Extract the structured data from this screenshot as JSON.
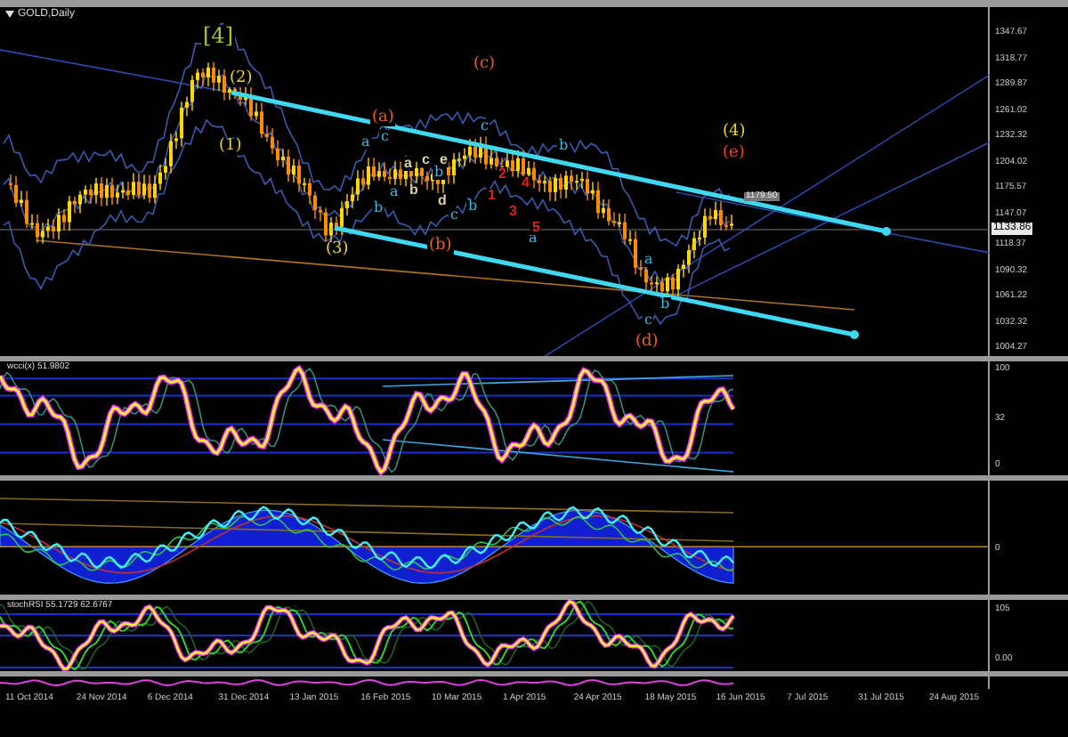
{
  "chart": {
    "title": "GOLD,Daily",
    "price_axis": [
      "1347.67",
      "1318.77",
      "1289.87",
      "1261.02",
      "1232.32",
      "1204.02",
      "1175.57",
      "1147.07",
      "1118.37",
      "1090.32",
      "1061.22",
      "1032.32",
      "1004.27"
    ],
    "current_price": "1133.86",
    "line_price": "1179.50",
    "wave_labels": [
      {
        "text": "[4]",
        "color": "#a8c832"
      },
      {
        "text": "(2)",
        "color": "#e8d040"
      },
      {
        "text": "(1)",
        "color": "#e8d040"
      },
      {
        "text": "(3)",
        "color": "#e8d040"
      },
      {
        "text": "(a)",
        "color": "#e8602a"
      },
      {
        "text": "(c)",
        "color": "#e8602a"
      },
      {
        "text": "(b)",
        "color": "#e8602a"
      },
      {
        "text": "(d)",
        "color": "#e8602a"
      },
      {
        "text": "(4)",
        "color": "#e8d040"
      },
      {
        "text": "(e)",
        "color": "#ff4020"
      },
      {
        "text": "a",
        "color": "#40b8e0"
      },
      {
        "text": "c",
        "color": "#40b8e0"
      },
      {
        "text": "b",
        "color": "#40b8e0"
      },
      {
        "text": "a",
        "color": "#40b8e0"
      },
      {
        "text": "b",
        "color": "#40b8e0"
      },
      {
        "text": "c",
        "color": "#40b8e0"
      },
      {
        "text": "b",
        "color": "#40b8e0"
      },
      {
        "text": "c",
        "color": "#40b8e0"
      },
      {
        "text": "b",
        "color": "#40b8e0"
      },
      {
        "text": "a",
        "color": "#40b8e0"
      },
      {
        "text": "a",
        "color": "#40b8e0"
      },
      {
        "text": "b",
        "color": "#40b8e0"
      },
      {
        "text": "c",
        "color": "#40b8e0"
      },
      {
        "text": "a",
        "color": "#d8d0a0"
      },
      {
        "text": "c",
        "color": "#d8d0a0"
      },
      {
        "text": "e",
        "color": "#d8d0a0"
      },
      {
        "text": "b",
        "color": "#d8d0a0"
      },
      {
        "text": "d",
        "color": "#d8d0a0"
      },
      {
        "text": "2",
        "color": "#e02020"
      },
      {
        "text": "1",
        "color": "#e02020"
      },
      {
        "text": "3",
        "color": "#e02020"
      },
      {
        "text": "4",
        "color": "#e02020"
      },
      {
        "text": "5",
        "color": "#e02020"
      }
    ]
  },
  "panels": [
    {
      "title": "wcci(x) 51.9802",
      "axis": [
        "100",
        "32",
        "0"
      ]
    },
    {
      "axis": [
        "0"
      ]
    },
    {
      "title": "stochRSI 55.1729 62.6767",
      "axis": [
        "105",
        "0.00"
      ]
    }
  ],
  "time_axis": [
    "11 Oct 2014",
    "24 Nov 2014",
    "6 Dec 2014",
    "31 Dec 2014",
    "13 Jan 2015",
    "16 Feb 2015",
    "10 Mar 2015",
    "1 Apr 2015",
    "24 Apr 2015",
    "18 May 2015",
    "16 Jun 2015",
    "7 Jul 2015",
    "31 Jul 2015",
    "24 Aug 2015"
  ]
}
